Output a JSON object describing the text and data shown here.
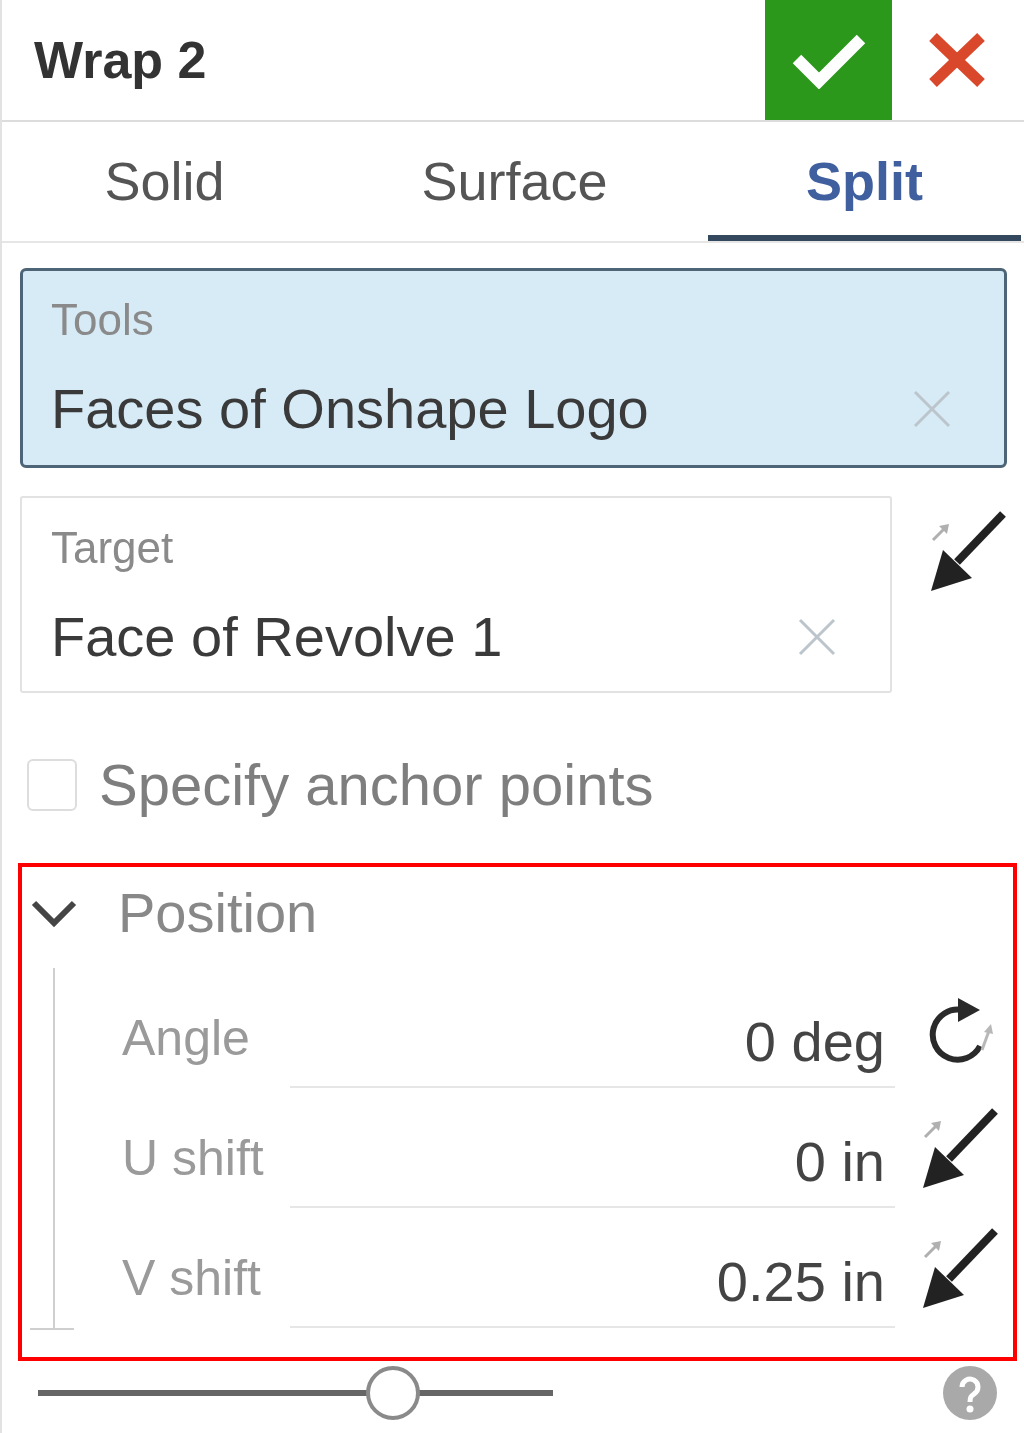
{
  "dialog": {
    "title": "Wrap 2"
  },
  "tabs": [
    {
      "label": "Solid",
      "selected": false
    },
    {
      "label": "Surface",
      "selected": false
    },
    {
      "label": "Split",
      "selected": true
    }
  ],
  "selection_fields": [
    {
      "label": "Tools",
      "value": "Faces of Onshape Logo",
      "active": true,
      "flip_button": false
    },
    {
      "label": "Target",
      "value": "Face of Revolve 1",
      "active": false,
      "flip_button": true
    }
  ],
  "anchor_checkbox": {
    "label": "Specify anchor points",
    "checked": false
  },
  "position": {
    "title": "Position",
    "expanded": true,
    "highlighted": true,
    "rows": [
      {
        "label": "Angle",
        "value": "0 deg",
        "kind": "rotate"
      },
      {
        "label": "U shift",
        "value": "0 in",
        "kind": "flip"
      },
      {
        "label": "V shift",
        "value": "0.25 in",
        "kind": "flip"
      }
    ]
  },
  "slider": {
    "level": 0.69
  }
}
